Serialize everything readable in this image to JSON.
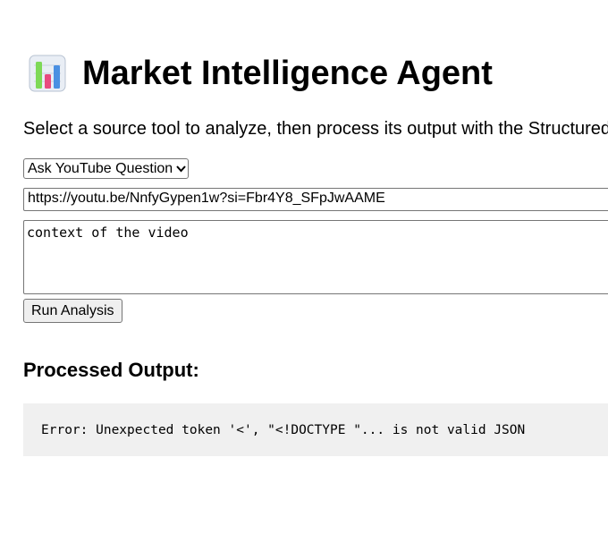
{
  "header": {
    "icon": "bar-chart-icon",
    "title": "Market Intelligence Agent",
    "subtitle": "Select a source tool to analyze, then process its output with the Structured"
  },
  "form": {
    "tool_select": {
      "selected": "Ask YouTube Question"
    },
    "url_input": {
      "value": "https://youtu.be/NnfyGypen1w?si=Fbr4Y8_SFpJwAAME"
    },
    "context_textarea": {
      "value": "context of the video"
    },
    "run_button_label": "Run Analysis"
  },
  "output": {
    "heading": "Processed Output:",
    "text": "Error: Unexpected token '<', \"<!DOCTYPE \"... is not valid JSON"
  },
  "colors": {
    "output_background": "#f0f0f0",
    "icon_bar_green": "#7ed957",
    "icon_bar_pink": "#e84a7f",
    "icon_bar_blue": "#4a90e2"
  }
}
